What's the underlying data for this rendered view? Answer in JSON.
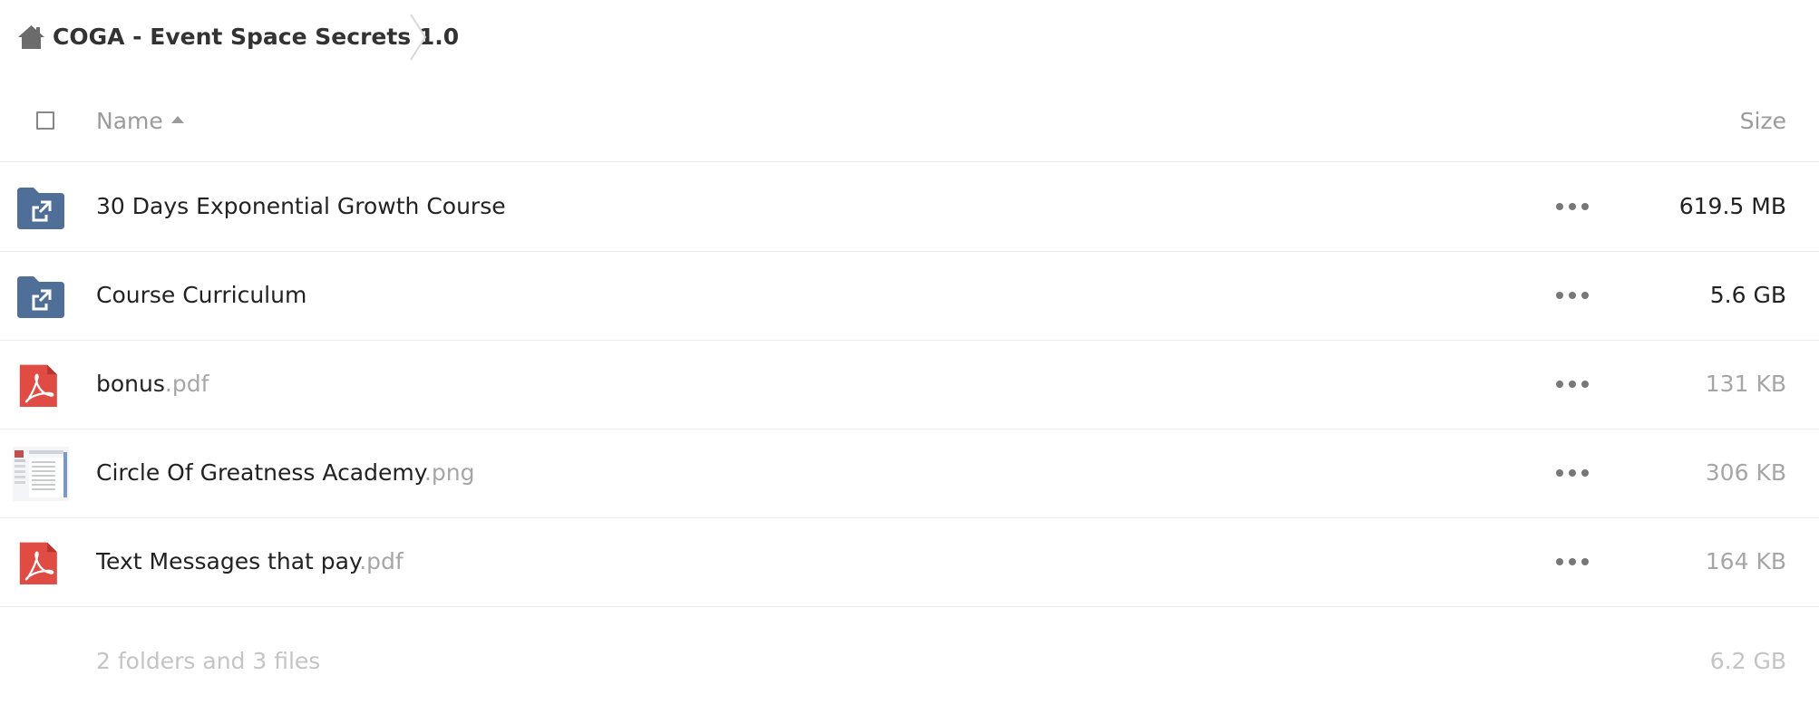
{
  "breadcrumb": {
    "home_icon": "home-icon",
    "title": "COGA - Event Space Secrets 1.0"
  },
  "table_header": {
    "name_label": "Name",
    "size_label": "Size",
    "sort": "ascending"
  },
  "files": [
    {
      "name": "30 Days Exponential Growth Course",
      "ext": "",
      "size": "619.5 MB",
      "icon": "shared-folder-icon"
    },
    {
      "name": "Course Curriculum",
      "ext": "",
      "size": "5.6 GB",
      "icon": "shared-folder-icon"
    },
    {
      "name": "bonus",
      "ext": ".pdf",
      "size": "131 KB",
      "icon": "pdf-icon"
    },
    {
      "name": "Circle Of Greatness Academy",
      "ext": ".png",
      "size": "306 KB",
      "icon": "image-thumbnail"
    },
    {
      "name": "Text Messages that pay",
      "ext": ".pdf",
      "size": "164 KB",
      "icon": "pdf-icon"
    }
  ],
  "summary": {
    "text": "2 folders and 3 files",
    "total_size": "6.2 GB"
  },
  "colors": {
    "folder": "#4f6e98",
    "pdf": "#e04c44",
    "text": "#222222",
    "muted": "#a6a6a6",
    "divider": "#ededed"
  }
}
